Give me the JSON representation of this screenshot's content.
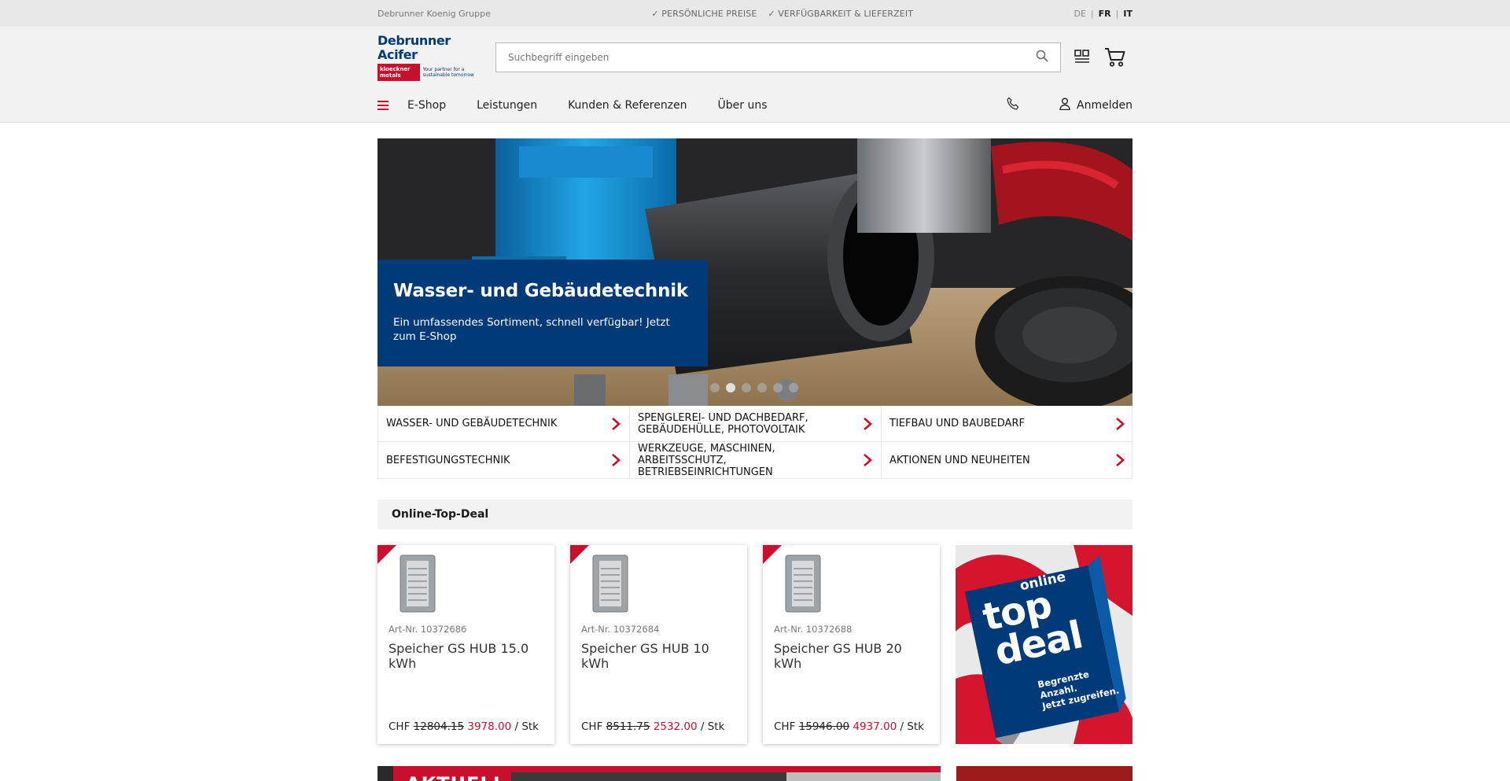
{
  "topbar": {
    "group": "Debrunner Koenig Gruppe",
    "usps": [
      "PERSÖNLICHE PREISE",
      "VERFÜGBARKEIT & LIEFERZEIT"
    ],
    "langs": [
      "DE",
      "FR",
      "IT"
    ]
  },
  "logo": {
    "brand": "Debrunner Acifer",
    "sub_brand": "kloeckner metals",
    "tagline": "Your partner for a sustainable tomorrow"
  },
  "search": {
    "placeholder": "Suchbegriff eingeben"
  },
  "nav": {
    "items": [
      "E-Shop",
      "Leistungen",
      "Kunden & Referenzen",
      "Über uns"
    ],
    "login": "Anmelden"
  },
  "hero": {
    "title": "Wasser- und Gebäudetechnik",
    "text": "Ein umfassendes Sortiment, schnell verfügbar! Jetzt zum E-Shop",
    "slide_count": 6,
    "active_slide": 1
  },
  "categories": [
    "WASSER- UND GEBÄUDETECHNIK",
    "SPENGLEREI- UND DACHBEDARF, GEBÄUDEHÜLLE, PHOTOVOLTAIK",
    "TIEFBAU UND BAUBEDARF",
    "BEFESTIGUNGSTECHNIK",
    "WERKZEUGE, MASCHINEN, ARBEITSSCHUTZ, BETRIEBSEINRICHTUNGEN",
    "AKTIONEN UND NEUHEITEN"
  ],
  "deal": {
    "heading": "Online-Top-Deal",
    "products": [
      {
        "art": "Art-Nr. 10372686",
        "name": "Speicher GS HUB 15.0 kWh",
        "currency": "CHF",
        "old_price": "12804.15",
        "new_price": "3978.00",
        "unit": "/ Stk"
      },
      {
        "art": "Art-Nr. 10372684",
        "name": "Speicher GS HUB 10 kWh",
        "currency": "CHF",
        "old_price": "8511.75",
        "new_price": "2532.00",
        "unit": "/ Stk"
      },
      {
        "art": "Art-Nr. 10372688",
        "name": "Speicher GS HUB 20 kWh",
        "currency": "CHF",
        "old_price": "15946.00",
        "new_price": "4937.00",
        "unit": "/ Stk"
      }
    ],
    "promo": {
      "line1": "online",
      "line2": "top",
      "line3": "deal",
      "sub1": "Begrenzte",
      "sub2": "Anzahl.",
      "sub3": "Jetzt zugreifen."
    }
  },
  "bottom": {
    "banner_label": "AKTUELL"
  },
  "colors": {
    "brand_blue": "#003a78",
    "brand_red": "#c8102e"
  }
}
